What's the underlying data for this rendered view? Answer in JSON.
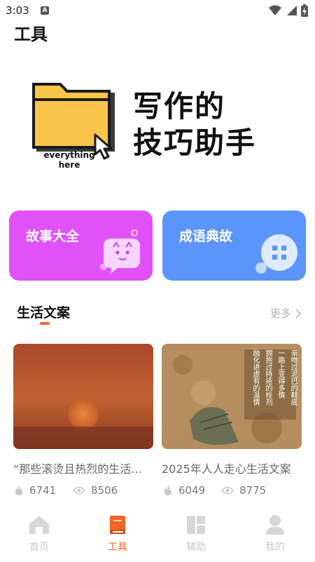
{
  "status_bar": {
    "time": "3:03",
    "notification_letter": "A"
  },
  "header": {
    "title": "工具"
  },
  "banner": {
    "line1": "写作的",
    "line2": "技巧助手",
    "caption_line1": "everything",
    "caption_line2": "here",
    "folder_icon": "folder-icon",
    "cursor_icon": "cursor-icon"
  },
  "feature_cards": [
    {
      "label": "故事大全",
      "icon": "chat-bubble-cat-icon",
      "color": "#e052f7"
    },
    {
      "label": "成语典故",
      "icon": "chat-bubble-grid-icon",
      "color": "#5b95fb"
    }
  ],
  "section": {
    "title": "生活文案",
    "more_label": "更多",
    "accent_color": "#f26522"
  },
  "articles": [
    {
      "title": "“那些滚烫且热烈的生活瞬间”",
      "likes": "6741",
      "views": "8506",
      "image": "sunset-image"
    },
    {
      "title": "2025年人人走心生活文案",
      "likes": "6049",
      "views": "8775",
      "image": "muddy-shoe-image",
      "image_text_columns": [
        "亲吻过泥巴的鞋底",
        "一路上变得多情",
        "拥抱过持疮的栓剂",
        "融化进虚有的温情"
      ]
    }
  ],
  "tabbar": {
    "tabs": [
      {
        "label": "首页",
        "icon": "home-icon",
        "active": false
      },
      {
        "label": "工具",
        "icon": "book-icon",
        "active": true
      },
      {
        "label": "辅助",
        "icon": "grid-icon",
        "active": false
      },
      {
        "label": "我的",
        "icon": "profile-icon",
        "active": false
      }
    ]
  }
}
